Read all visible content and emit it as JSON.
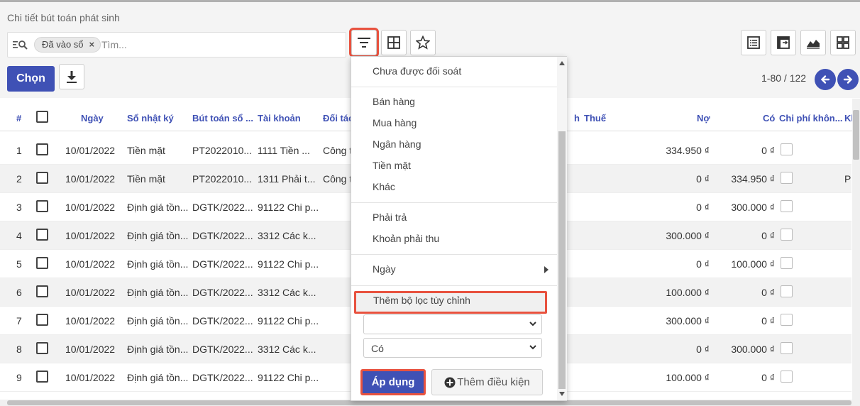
{
  "breadcrumb": "Chi tiết bút toán phát sinh",
  "search": {
    "facet_label": "Đã vào sổ",
    "facet_remove": "×",
    "placeholder": "Tìm..."
  },
  "buttons": {
    "select": "Chọn"
  },
  "pager": {
    "value": "1-80 / 122"
  },
  "table": {
    "columns": [
      "#",
      "Ngày",
      "Sổ nhật ký",
      "Bút toán sổ ...",
      "Tài khoản",
      "Đối tác",
      "h",
      "Thuế",
      "Nợ",
      "Có",
      "Chi phí khôn...",
      "Kl"
    ],
    "rows": [
      {
        "n": "1",
        "date": "10/01/2022",
        "journal": "Tiền mặt",
        "entry": "PT2022010...",
        "account": "1111 Tiền ...",
        "partner": "Công t",
        "debit": "334.950 ₫",
        "credit": "0 ₫",
        "extra": ""
      },
      {
        "n": "2",
        "date": "10/01/2022",
        "journal": "Tiền mặt",
        "entry": "PT2022010...",
        "account": "1311 Phải t...",
        "partner": "Công t",
        "debit": "0 ₫",
        "credit": "334.950 ₫",
        "extra": "P"
      },
      {
        "n": "3",
        "date": "10/01/2022",
        "journal": "Định giá tồn...",
        "entry": "DGTK/2022...",
        "account": "91122 Chi p...",
        "partner": "",
        "debit": "0 ₫",
        "credit": "300.000 ₫",
        "extra": ""
      },
      {
        "n": "4",
        "date": "10/01/2022",
        "journal": "Định giá tồn...",
        "entry": "DGTK/2022...",
        "account": "3312 Các k...",
        "partner": "",
        "debit": "300.000 ₫",
        "credit": "0 ₫",
        "extra": ""
      },
      {
        "n": "5",
        "date": "10/01/2022",
        "journal": "Định giá tồn...",
        "entry": "DGTK/2022...",
        "account": "91122 Chi p...",
        "partner": "",
        "debit": "0 ₫",
        "credit": "100.000 ₫",
        "extra": ""
      },
      {
        "n": "6",
        "date": "10/01/2022",
        "journal": "Định giá tồn...",
        "entry": "DGTK/2022...",
        "account": "3312 Các k...",
        "partner": "",
        "debit": "100.000 ₫",
        "credit": "0 ₫",
        "extra": ""
      },
      {
        "n": "7",
        "date": "10/01/2022",
        "journal": "Định giá tồn...",
        "entry": "DGTK/2022...",
        "account": "91122 Chi p...",
        "partner": "",
        "debit": "300.000 ₫",
        "credit": "0 ₫",
        "extra": ""
      },
      {
        "n": "8",
        "date": "10/01/2022",
        "journal": "Định giá tồn...",
        "entry": "DGTK/2022...",
        "account": "3312 Các k...",
        "partner": "",
        "debit": "0 ₫",
        "credit": "300.000 ₫",
        "extra": ""
      },
      {
        "n": "9",
        "date": "10/01/2022",
        "journal": "Định giá tồn...",
        "entry": "DGTK/2022...",
        "account": "91122 Chi p...",
        "partner": "",
        "debit": "100.000 ₫",
        "credit": "0 ₫",
        "extra": ""
      }
    ]
  },
  "filter_menu": {
    "items": [
      "Chưa được đối soát",
      "Bán hàng",
      "Mua hàng",
      "Ngân hàng",
      "Tiền mặt",
      "Khác",
      "Phải trả",
      "Khoản phải thu",
      "Ngày"
    ],
    "custom_filter": "Thêm bộ lọc tùy chỉnh",
    "field_select_value": "",
    "operator_select_value": "Có",
    "apply": "Áp dụng",
    "add_condition": "Thêm điều kiện"
  },
  "colors": {
    "primary": "#3f51b5",
    "highlight": "#e8523f"
  }
}
